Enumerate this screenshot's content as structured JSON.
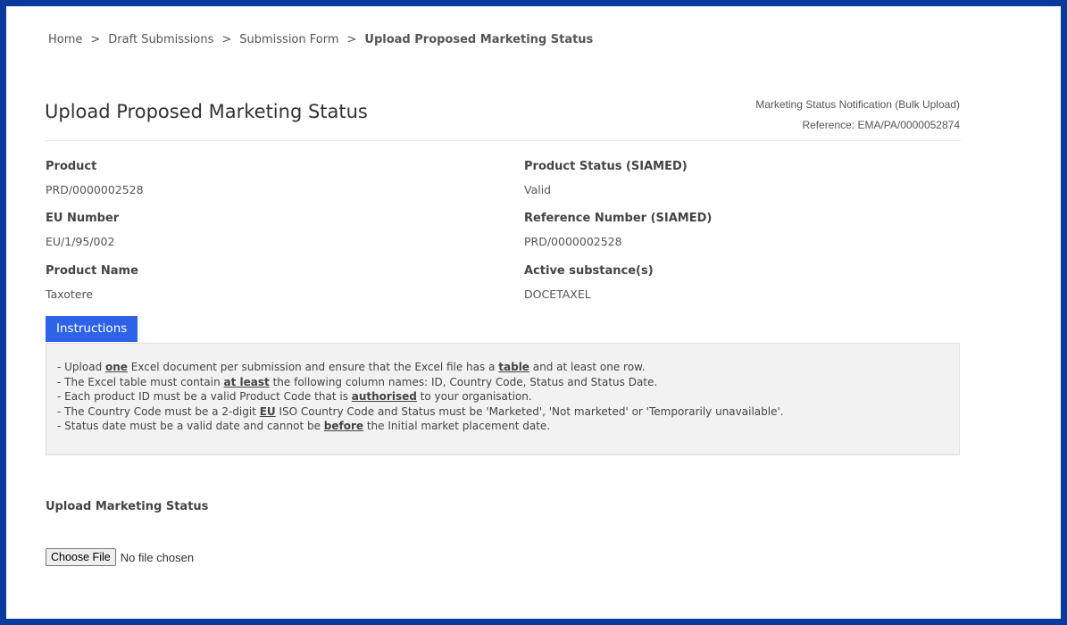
{
  "breadcrumb": {
    "items": [
      "Home",
      "Draft Submissions",
      "Submission Form"
    ],
    "separator": ">",
    "current": "Upload Proposed Marketing Status"
  },
  "page": {
    "title": "Upload Proposed Marketing Status",
    "notification_type": "Marketing Status Notification (Bulk Upload)",
    "reference": "Reference: EMA/PA/0000052874"
  },
  "details": {
    "product_label": "Product",
    "product_value": "PRD/0000002528",
    "eu_number_label": "EU Number",
    "eu_number_value": "EU/1/95/002",
    "product_name_label": "Product Name",
    "product_name_value": "Taxotere",
    "product_status_label": "Product Status (SIAMED)",
    "product_status_value": "Valid",
    "reference_number_label": "Reference Number (SIAMED)",
    "reference_number_value": "PRD/0000002528",
    "active_substance_label": "Active substance(s)",
    "active_substance_value": "DOCETAXEL"
  },
  "instructions": {
    "tab_label": "Instructions",
    "line1": [
      "- Upload ",
      "one",
      " Excel document per submission and ensure that the Excel file has a ",
      "table",
      " and at least one row."
    ],
    "line2": [
      "- The Excel table must contain ",
      "at least",
      " the following column names: ID, Country Code, Status and Status Date."
    ],
    "line3": [
      "- Each product ID must be a valid Product Code that is ",
      "authorised",
      " to your organisation."
    ],
    "line4": [
      "- The Country Code must be a 2-digit ",
      "EU",
      " ISO Country Code and Status must be 'Marketed', 'Not marketed' or 'Temporarily unavailable'."
    ],
    "line5": [
      "- Status date must be a valid date and cannot be ",
      "before",
      " the Initial market placement date."
    ]
  },
  "upload": {
    "label": "Upload Marketing Status",
    "button_label": "Choose File",
    "status": "No file chosen"
  },
  "colors": {
    "frame_border": "#0a3a9e",
    "tab_background": "#2e62e8",
    "instructions_background": "#f2f2f2"
  }
}
